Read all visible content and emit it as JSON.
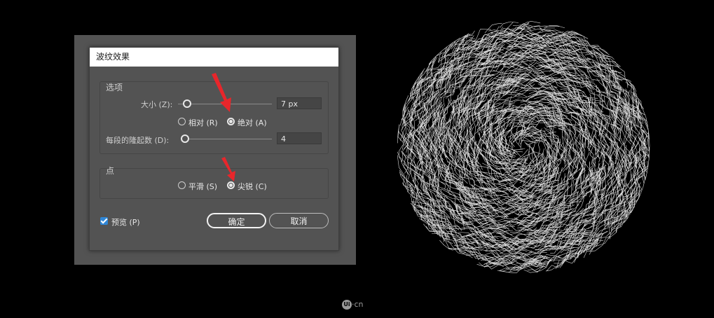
{
  "dialog": {
    "title": "波纹效果",
    "options_group": {
      "title": "选项",
      "size_label": "大小 (Z):",
      "size_value": "7 px",
      "size_slider_fraction": 0.02,
      "relative_label": "相对 (R)",
      "absolute_label": "绝对 (A)",
      "selected_mode": "absolute",
      "ridges_label": "每段的隆起数 (D):",
      "ridges_value": "4",
      "ridges_slider_fraction": 0.0
    },
    "points_group": {
      "title": "点",
      "smooth_label": "平滑 (S)",
      "corner_label": "尖锐 (C)",
      "selected_point": "corner"
    },
    "preview_label": "预览 (P)",
    "preview_checked": true,
    "ok_label": "确定",
    "cancel_label": "取消"
  },
  "watermark": {
    "logo_text": "Ui",
    "suffix": "·cn"
  },
  "colors": {
    "background": "#000000",
    "panel": "#535353",
    "checkbox_accent": "#2f86d6",
    "annotation_arrow": "#e8262b"
  },
  "icons": [
    "red-annotation-arrow-icon",
    "ui-cn-logo-icon"
  ]
}
